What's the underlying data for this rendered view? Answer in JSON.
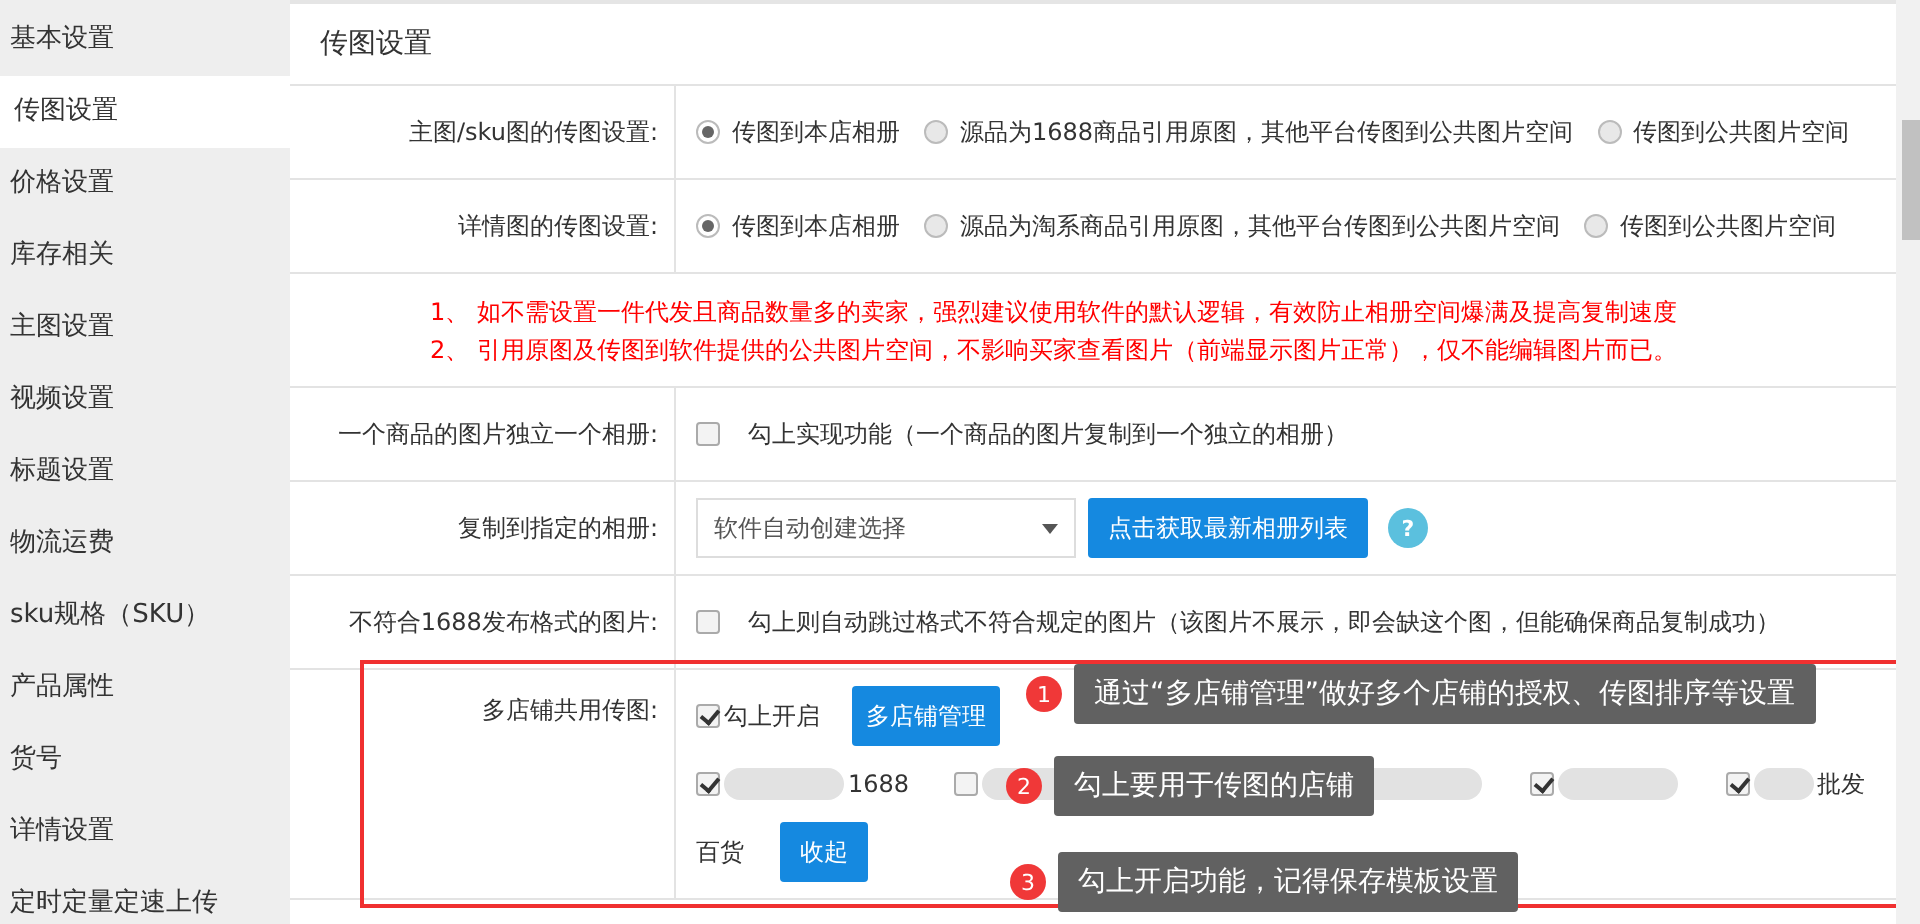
{
  "sidebar": {
    "items": [
      {
        "label": "基本设置",
        "selected": false
      },
      {
        "label": "传图设置",
        "selected": true
      },
      {
        "label": "价格设置",
        "selected": false
      },
      {
        "label": "库存相关",
        "selected": false
      },
      {
        "label": "主图设置",
        "selected": false
      },
      {
        "label": "视频设置",
        "selected": false
      },
      {
        "label": "标题设置",
        "selected": false
      },
      {
        "label": "物流运费",
        "selected": false
      },
      {
        "label": "sku规格（SKU）",
        "selected": false
      },
      {
        "label": "产品属性",
        "selected": false
      },
      {
        "label": "货号",
        "selected": false
      },
      {
        "label": "详情设置",
        "selected": false
      },
      {
        "label": "定时定量定速上传",
        "selected": false
      }
    ]
  },
  "section_title": "传图设置",
  "rows": [
    {
      "kind": "radio",
      "label": "主图/sku图的传图设置:",
      "options": [
        {
          "label": "传图到本店相册",
          "selected": true
        },
        {
          "label": "源品为1688商品引用原图，其他平台传图到公共图片空间",
          "selected": false
        },
        {
          "label": "传图到公共图片空间",
          "selected": false
        }
      ]
    },
    {
      "kind": "radio",
      "label": "详情图的传图设置:",
      "options": [
        {
          "label": "传图到本店相册",
          "selected": true
        },
        {
          "label": "源品为淘系商品引用原图，其他平台传图到公共图片空间",
          "selected": false
        },
        {
          "label": "传图到公共图片空间",
          "selected": false
        }
      ]
    },
    {
      "kind": "notes",
      "notes": [
        "1、 如不需设置一件代发且商品数量多的卖家，强烈建议使用软件的默认逻辑，有效防止相册空间爆满及提高复制速度",
        "2、 引用原图及传图到软件提供的公共图片空间，不影响买家查看图片（前端显示图片正常），仅不能编辑图片而已。"
      ]
    },
    {
      "kind": "checkbox",
      "label": "一个商品的图片独立一个相册:",
      "text": "勾上实现功能（一个商品的图片复制到一个独立的相册）",
      "checked": false
    },
    {
      "kind": "select",
      "label": "复制到指定的相册:",
      "value": "软件自动创建选择",
      "button": "点击获取最新相册列表",
      "help": "?"
    },
    {
      "kind": "checkbox",
      "label": "不符合1688发布格式的图片:",
      "text": "勾上则自动跳过格式不符合规定的图片（该图片不展示，即会缺这个图，但能确保商品复制成功）",
      "checked": false
    },
    {
      "kind": "shops",
      "label": "多店铺共用传图:",
      "enable_text": "勾上开启",
      "checked": true,
      "manage_button": "多店铺管理",
      "shops": [
        {
          "label": "1688",
          "checked": true
        },
        {
          "checked": false
        },
        {
          "checked": true
        },
        {
          "label": "批发",
          "checked": true
        }
      ],
      "wrapped_text": "百货",
      "collapse_button": "收起"
    }
  ],
  "annotations": [
    {
      "number": "1",
      "text": "通过“多店铺管理”做好多个店铺的授权、传图排序等设置"
    },
    {
      "number": "2",
      "text": "勾上要用于传图的店铺"
    },
    {
      "number": "3",
      "text": "勾上开启功能，记得保存模板设置"
    }
  ]
}
